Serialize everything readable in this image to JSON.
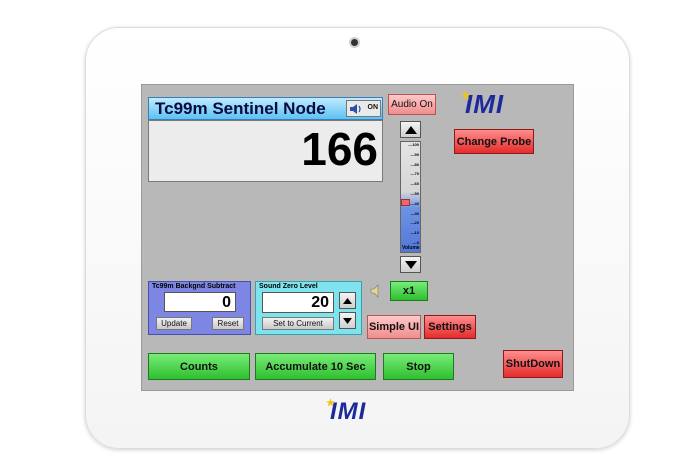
{
  "node": {
    "title": "Tc99m Sentinel Node",
    "count": "166",
    "speaker_state": "ON"
  },
  "audio": {
    "toggle_label": "Audio On",
    "multiplier": "x1"
  },
  "volume": {
    "ticks": [
      "100",
      "90",
      "80",
      "70",
      "60",
      "50",
      "40",
      "30",
      "20",
      "10",
      "0"
    ],
    "label": "Volume",
    "level": 0.42
  },
  "buttons": {
    "change_probe": "Change Probe",
    "simple_ui": "Simple UI",
    "settings": "Settings",
    "counts": "Counts",
    "accumulate": "Accumulate 10 Sec",
    "stop": "Stop",
    "shutdown": "ShutDown"
  },
  "background": {
    "label": "Tc99m Backgnd Subtract",
    "value": "0",
    "update": "Update",
    "reset": "Reset"
  },
  "sound_zero": {
    "label": "Sound Zero Level",
    "value": "20",
    "set_current": "Set to Current"
  },
  "logo": {
    "text": "IMI"
  }
}
